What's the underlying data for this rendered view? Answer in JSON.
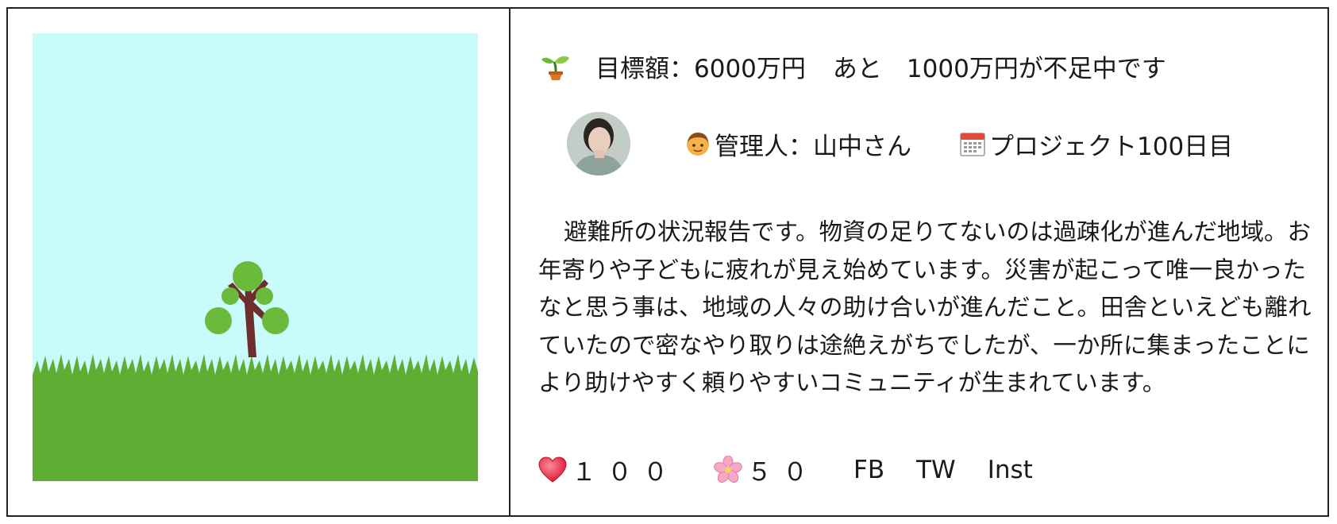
{
  "goal": {
    "label": "目標額：6000万円",
    "remaining": "あと　1000万円が不足中です",
    "icon": "seedling-icon"
  },
  "manager": {
    "label": "管理人：山中さん",
    "icon": "person-face-icon"
  },
  "project": {
    "label": "プロジェクト100日目",
    "icon": "calendar-icon"
  },
  "report": {
    "text": "避難所の状況報告です。物資の足りてないのは過疎化が進んだ地域。お年寄りや子どもに疲れが見え始めています。災害が起こって唯一良かったなと思う事は、地域の人々の助け合いが進んだこと。田舎といえども離れていたので密なやり取りは途絶えがちでしたが、一か所に集まったことにより助けやすく頼りやすいコミュニティが生まれています。"
  },
  "reactions": {
    "heart_count": "１００",
    "flower_count": "５０",
    "heart_icon": "heart-icon",
    "flower_icon": "cherry-blossom-icon"
  },
  "social": {
    "fb": "FB",
    "tw": "TW",
    "inst": "Inst"
  },
  "colors": {
    "sky": "#c9fbfb",
    "grass": "#5eae34",
    "leaf": "#6cba3c",
    "trunk": "#6e2e2e",
    "border": "#222222"
  }
}
